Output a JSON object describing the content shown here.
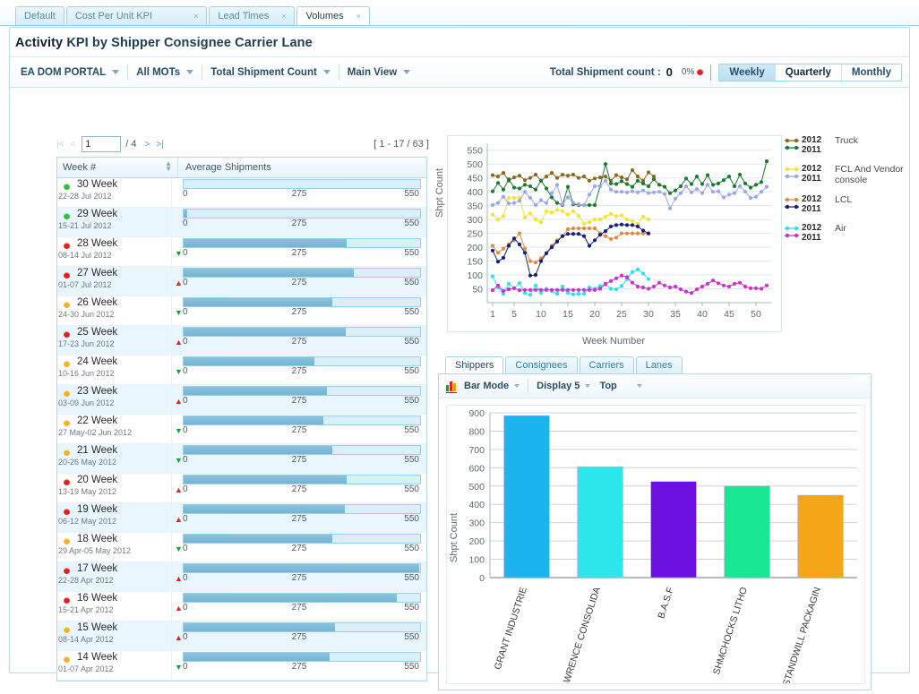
{
  "tabs": [
    {
      "label": "Default",
      "active": false,
      "closable": false
    },
    {
      "label": "Cost Per Unit KPI",
      "active": false,
      "closable": true
    },
    {
      "label": "Lead Times",
      "active": false,
      "closable": true
    },
    {
      "label": "Volumes",
      "active": true,
      "closable": true
    }
  ],
  "page": {
    "title_prefix": "Activity",
    "title": "KPI by Shipper Consignee Carrier Lane"
  },
  "toolbar": {
    "filters": [
      {
        "label": "EA DOM PORTAL"
      },
      {
        "label": "All MOTs"
      },
      {
        "label": "Total Shipment Count"
      },
      {
        "label": "Main View"
      }
    ],
    "stat_label": "Total Shipment count :",
    "stat_value": "0",
    "stat_pct": "0%",
    "stat_dot_color": "#e02020",
    "periods": [
      {
        "label": "Weekly",
        "state": "selected"
      },
      {
        "label": "Quarterly",
        "state": "current"
      },
      {
        "label": "Monthly",
        "state": "normal"
      }
    ]
  },
  "table": {
    "pager": {
      "first": "|<",
      "prev": "<",
      "next": ">",
      "last": ">|",
      "page_value": "1",
      "of_text": "/ 4",
      "range_text": "[ 1 - 17 / 63 ]"
    },
    "columns": [
      "Week #",
      "Average Shipments"
    ],
    "axis": {
      "min": "0",
      "mid": "275",
      "max": "550"
    },
    "rows": [
      {
        "week": "30 Week",
        "date": "22-28 Jul 2012",
        "status": "#2fbf3f",
        "trend": "",
        "value": 0
      },
      {
        "week": "29 Week",
        "date": "15-21 Jul 2012",
        "status": "#2fbf3f",
        "trend": "",
        "value": 8
      },
      {
        "week": "28 Week",
        "date": "08-14 Jul 2012",
        "status": "#e02020",
        "trend": "down",
        "value": 380
      },
      {
        "week": "27 Week",
        "date": "01-07 Jul 2012",
        "status": "#e02020",
        "trend": "up",
        "value": 395
      },
      {
        "week": "26 Week",
        "date": "24-30 Jun 2012",
        "status": "#f0b323",
        "trend": "down",
        "value": 345
      },
      {
        "week": "25 Week",
        "date": "17-23 Jun 2012",
        "status": "#e02020",
        "trend": "up",
        "value": 378
      },
      {
        "week": "24 Week",
        "date": "10-16 Jun 2012",
        "status": "#f0b323",
        "trend": "down",
        "value": 305
      },
      {
        "week": "23 Week",
        "date": "03-09 Jun 2012",
        "status": "#f0b323",
        "trend": "up",
        "value": 333
      },
      {
        "week": "22 Week",
        "date": "27 May-02 Jun 2012",
        "status": "#f0b323",
        "trend": "down",
        "value": 325
      },
      {
        "week": "21 Week",
        "date": "20-26 May 2012",
        "status": "#f0b323",
        "trend": "down",
        "value": 345
      },
      {
        "week": "20 Week",
        "date": "13-19 May 2012",
        "status": "#e02020",
        "trend": "up",
        "value": 380
      },
      {
        "week": "19 Week",
        "date": "06-12 May 2012",
        "status": "#e02020",
        "trend": "up",
        "value": 375
      },
      {
        "week": "18 Week",
        "date": "29 Apr-05 May 2012",
        "status": "#f0b323",
        "trend": "down",
        "value": 345
      },
      {
        "week": "17 Week",
        "date": "22-28 Apr 2012",
        "status": "#e02020",
        "trend": "up",
        "value": 548
      },
      {
        "week": "16 Week",
        "date": "15-21 Apr 2012",
        "status": "#e02020",
        "trend": "up",
        "value": 495
      },
      {
        "week": "15 Week",
        "date": "08-14 Apr 2012",
        "status": "#f0b323",
        "trend": "up",
        "value": 352
      },
      {
        "week": "14 Week",
        "date": "01-07 Apr 2012",
        "status": "#f0b323",
        "trend": "down",
        "value": 340
      }
    ]
  },
  "chart_data": [
    {
      "type": "line",
      "title": "",
      "xlabel": "Week Number",
      "ylabel": "Shpt Count",
      "xlim": [
        0,
        53
      ],
      "ylim": [
        0,
        575
      ],
      "yticks": [
        50,
        100,
        150,
        200,
        250,
        300,
        350,
        400,
        450,
        500,
        550
      ],
      "xticks": [
        1,
        5,
        10,
        15,
        20,
        25,
        30,
        35,
        40,
        45,
        50
      ],
      "grid": true,
      "legend_position": "right",
      "legend": [
        {
          "year_top": "2012",
          "year_bottom": "2011",
          "name": "Truck",
          "color_top": "#8a6a1e",
          "color_bottom": "#1d7a33"
        },
        {
          "year_top": "2012",
          "year_bottom": "2011",
          "name": "FCL And Vendor console",
          "color_top": "#f2e338",
          "color_bottom": "#9aa7e8"
        },
        {
          "year_top": "2012",
          "year_bottom": "2011",
          "name": "LCL",
          "color_top": "#e08a46",
          "color_bottom": "#14207a"
        },
        {
          "year_top": "2012",
          "year_bottom": "2011",
          "name": "Air",
          "color_top": "#2fe0e8",
          "color_bottom": "#cc33cc"
        }
      ],
      "series": [
        {
          "name": "Truck 2012",
          "color": "#8a6a1e",
          "values": [
            460,
            455,
            468,
            440,
            452,
            458,
            442,
            450,
            462,
            440,
            455,
            468,
            450,
            462,
            458,
            462,
            450,
            455,
            440,
            448,
            452,
            455,
            440,
            460,
            452,
            445,
            478,
            455,
            440,
            470,
            455,
            null,
            null,
            null,
            null,
            null,
            null,
            null,
            null,
            null,
            null,
            null,
            null,
            null,
            null,
            null,
            null,
            null,
            null,
            null,
            null,
            null
          ]
        },
        {
          "name": "Truck 2011",
          "color": "#1d7a33",
          "values": [
            402,
            432,
            408,
            445,
            415,
            412,
            425,
            420,
            408,
            440,
            412,
            380,
            360,
            352,
            418,
            355,
            352,
            352,
            352,
            352,
            420,
            500,
            430,
            428,
            438,
            428,
            418,
            440,
            430,
            420,
            445,
            425,
            418,
            395,
            405,
            420,
            448,
            428,
            455,
            428,
            460,
            425,
            430,
            442,
            455,
            420,
            462,
            430,
            415,
            425,
            435,
            510
          ],
          "note": "2011 truck series spans full year"
        },
        {
          "name": "FCL 2012",
          "color": "#f2e338",
          "values": [
            318,
            300,
            312,
            378,
            378,
            378,
            308,
            322,
            300,
            290,
            330,
            325,
            335,
            330,
            318,
            330,
            312,
            285,
            290,
            300,
            300,
            310,
            320,
            312,
            315,
            300,
            295,
            285,
            310,
            300,
            null,
            null,
            null,
            null,
            null,
            null,
            null,
            null,
            null,
            null,
            null,
            null,
            null,
            null,
            null,
            null,
            null,
            null,
            null,
            null,
            null,
            null
          ]
        },
        {
          "name": "FCL 2011",
          "color": "#9aa7e8",
          "values": [
            352,
            360,
            382,
            358,
            360,
            368,
            400,
            378,
            352,
            370,
            360,
            395,
            425,
            355,
            380,
            360,
            355,
            352,
            390,
            420,
            420,
            440,
            408,
            400,
            400,
            398,
            402,
            398,
            405,
            395,
            398,
            400,
            392,
            340,
            375,
            395,
            420,
            398,
            410,
            395,
            425,
            400,
            402,
            380,
            390,
            395,
            420,
            400,
            378,
            382,
            400,
            418
          ]
        },
        {
          "name": "LCL 2012",
          "color": "#e08a46",
          "values": [
            205,
            180,
            195,
            210,
            225,
            250,
            195,
            150,
            145,
            160,
            180,
            205,
            225,
            240,
            265,
            268,
            268,
            268,
            268,
            268,
            250,
            240,
            230,
            235,
            250,
            250,
            250,
            250,
            250,
            250,
            null,
            null,
            null,
            null,
            null,
            null,
            null,
            null,
            null,
            null,
            null,
            null,
            null,
            null,
            null,
            null,
            null,
            null,
            null,
            null,
            null,
            null
          ]
        },
        {
          "name": "LCL 2011",
          "color": "#14207a",
          "values": [
            188,
            148,
            162,
            205,
            232,
            210,
            180,
            98,
            100,
            150,
            178,
            200,
            220,
            240,
            248,
            248,
            248,
            240,
            205,
            225,
            245,
            258,
            275,
            280,
            282,
            280,
            280,
            275,
            260,
            250,
            null,
            null,
            null,
            null,
            null,
            null,
            null,
            null,
            null,
            null,
            null,
            null,
            null,
            null,
            null,
            null,
            null,
            null,
            null,
            null,
            null,
            null
          ]
        },
        {
          "name": "Air 2012",
          "color": "#2fe0e8",
          "values": [
            95,
            55,
            32,
            68,
            52,
            70,
            35,
            28,
            62,
            35,
            50,
            42,
            32,
            58,
            35,
            30,
            32,
            32,
            55,
            50,
            60,
            65,
            50,
            48,
            60,
            85,
            110,
            120,
            105,
            85,
            null,
            null,
            null,
            null,
            null,
            null,
            null,
            null,
            null,
            null,
            null,
            null,
            null,
            null,
            null,
            null,
            null,
            null,
            null,
            null,
            null,
            null
          ]
        },
        {
          "name": "Air 2011",
          "color": "#cc33cc",
          "values": [
            45,
            62,
            42,
            48,
            52,
            45,
            46,
            46,
            46,
            46,
            46,
            46,
            46,
            46,
            46,
            46,
            46,
            46,
            46,
            46,
            50,
            68,
            78,
            88,
            98,
            92,
            72,
            58,
            55,
            50,
            58,
            72,
            62,
            55,
            58,
            48,
            40,
            35,
            48,
            58,
            68,
            80,
            70,
            62,
            58,
            68,
            72,
            58,
            52,
            52,
            50,
            62
          ]
        }
      ]
    },
    {
      "type": "bar",
      "title": "",
      "xlabel": "",
      "ylabel": "Shpt Count",
      "ylim": [
        0,
        900
      ],
      "yticks": [
        0,
        100,
        200,
        300,
        400,
        500,
        600,
        700,
        800,
        900
      ],
      "grid": true,
      "categories": [
        "GRANT INDUSTRIE",
        "LAWRENCE CONSOLIDA",
        "B.A.S.F",
        "SHMCHOCKS LITHO",
        "STANDWILL PACKAGIN"
      ],
      "values": [
        885,
        605,
        525,
        500,
        450
      ],
      "colors": [
        "#1bb4ee",
        "#2ae7ec",
        "#6a11e0",
        "#17e891",
        "#f4a518"
      ]
    }
  ],
  "bottom_panel": {
    "tabs": [
      {
        "label": "Shippers",
        "active": true
      },
      {
        "label": "Consignees",
        "active": false
      },
      {
        "label": "Carriers",
        "active": false
      },
      {
        "label": "Lanes",
        "active": false
      }
    ],
    "toolbar": {
      "mode_label": "Bar Mode",
      "display_label": "Display 5",
      "top_label": "Top"
    }
  }
}
